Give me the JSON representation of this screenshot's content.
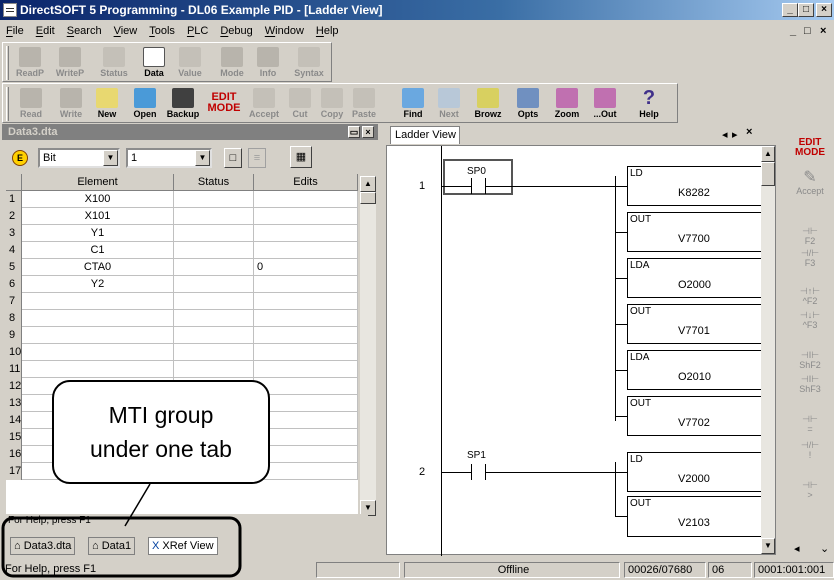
{
  "window": {
    "title": "DirectSOFT 5 Programming - DL06 Example PID - [Ladder View]",
    "min": "_",
    "max": "□",
    "close": "×",
    "child_min": "_",
    "child_max": "□",
    "child_close": "×"
  },
  "menu": [
    "File",
    "Edit",
    "Search",
    "View",
    "Tools",
    "PLC",
    "Debug",
    "Window",
    "Help"
  ],
  "toolbar1": [
    {
      "label": "ReadP",
      "on": false
    },
    {
      "label": "WriteP",
      "on": false
    },
    {
      "label": "Status",
      "on": false
    },
    {
      "label": "Data",
      "on": true
    },
    {
      "label": "Value",
      "on": false
    },
    {
      "label": "Mode",
      "on": false
    },
    {
      "label": "Info",
      "on": false
    },
    {
      "label": "Syntax",
      "on": false
    }
  ],
  "toolbar2": [
    {
      "label": "Read",
      "on": false
    },
    {
      "label": "Write",
      "on": false
    },
    {
      "label": "New",
      "on": true
    },
    {
      "label": "Open",
      "on": true
    },
    {
      "label": "Backup",
      "on": true
    },
    {
      "label": "Edit Mode",
      "on": true
    },
    {
      "label": "Accept",
      "on": false
    },
    {
      "label": "Cut",
      "on": false
    },
    {
      "label": "Copy",
      "on": false
    },
    {
      "label": "Paste",
      "on": false
    },
    {
      "label": "Find",
      "on": true
    },
    {
      "label": "Next",
      "on": false
    },
    {
      "label": "Browz",
      "on": true
    },
    {
      "label": "Opts",
      "on": true
    },
    {
      "label": "Zoom",
      "on": true
    },
    {
      "label": "...Out",
      "on": true
    },
    {
      "label": "Help",
      "on": true
    }
  ],
  "edit_mode_text": [
    "EDIT",
    "MODE"
  ],
  "data_panel": {
    "title": "Data3.dta",
    "format": "Bit",
    "count": "1",
    "columns": [
      "Element",
      "Status",
      "Edits"
    ],
    "rows": [
      [
        "X100",
        "",
        ""
      ],
      [
        "X101",
        "",
        ""
      ],
      [
        "Y1",
        "",
        ""
      ],
      [
        "C1",
        "",
        ""
      ],
      [
        "CTA0",
        "",
        "0"
      ],
      [
        "Y2",
        "",
        ""
      ],
      [
        "",
        "",
        ""
      ],
      [
        "",
        "",
        ""
      ],
      [
        "",
        "",
        ""
      ],
      [
        "",
        "",
        ""
      ],
      [
        "",
        "",
        ""
      ],
      [
        "",
        "",
        ""
      ],
      [
        "",
        "",
        ""
      ],
      [
        "",
        "",
        ""
      ],
      [
        "",
        "",
        ""
      ],
      [
        "",
        "",
        ""
      ],
      [
        "",
        "",
        ""
      ]
    ],
    "row_numbers": [
      "1",
      "2",
      "3",
      "4",
      "5",
      "6",
      "7",
      "8",
      "9",
      "10",
      "11",
      "12",
      "13",
      "14",
      "15",
      "16",
      "17"
    ],
    "help": "For Help, press F1",
    "tabs": [
      "Data3.dta",
      "Data1",
      "XRef View"
    ]
  },
  "ladder": {
    "tab": "Ladder View",
    "rungs": [
      {
        "number": "1",
        "contact": "SP0"
      },
      {
        "number": "2",
        "contact": "SP1"
      }
    ],
    "boxes": [
      [
        "LD",
        "K8282"
      ],
      [
        "OUT",
        "V7700"
      ],
      [
        "LDA",
        "O2000"
      ],
      [
        "OUT",
        "V7701"
      ],
      [
        "LDA",
        "O2010"
      ],
      [
        "OUT",
        "V7702"
      ],
      [
        "LD",
        "V2000"
      ],
      [
        "OUT",
        "V2103"
      ]
    ]
  },
  "right_toolbar": [
    "Accept",
    "F2",
    "F3",
    "^F2",
    "^F3",
    "ShF2",
    "ShF3",
    "=",
    "!",
    ">"
  ],
  "callout": [
    "MTI group",
    "under one tab"
  ],
  "status": {
    "help": "For Help, press F1",
    "mode": "Offline",
    "counter": "00026/07680",
    "num": "06",
    "pos": "0001:001:001"
  }
}
